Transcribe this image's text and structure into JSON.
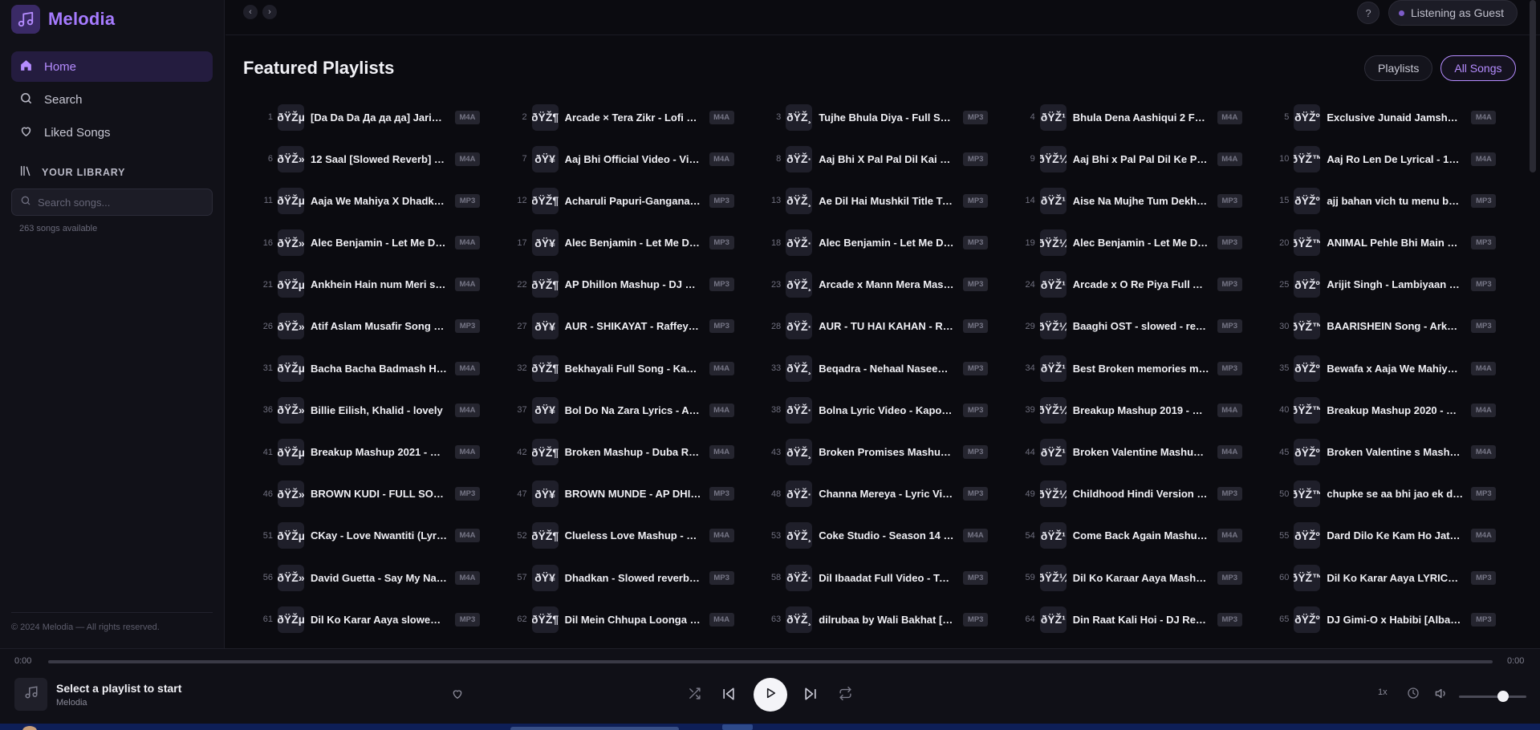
{
  "app": {
    "name": "Melodia"
  },
  "sidebar": {
    "nav": [
      {
        "label": "Home",
        "icon": "home-icon",
        "active": true
      },
      {
        "label": "Search",
        "icon": "search-icon",
        "active": false
      },
      {
        "label": "Liked Songs",
        "icon": "heart-icon",
        "active": false
      }
    ],
    "library_heading": "YOUR LIBRARY",
    "search_placeholder": "Search songs...",
    "songs_available": "263 songs available",
    "footer": "© 2024 Melodia — All rights reserved."
  },
  "topbar": {
    "back_label": "‹",
    "forward_label": "›",
    "help_label": "?",
    "guest_label": "Listening as Guest"
  },
  "main": {
    "title": "Featured Playlists",
    "toggle": [
      {
        "label": "Playlists",
        "active": false
      },
      {
        "label": "All Songs",
        "active": true
      }
    ]
  },
  "songs": [
    {
      "n": "1",
      "art": "ðŸŽµ",
      "title": "[Da Da Da Да да да] Jaric…",
      "fmt": "M4A"
    },
    {
      "n": "2",
      "art": "ðŸŽ¶",
      "title": "Arcade × Tera Zikr - Lofi …",
      "fmt": "M4A"
    },
    {
      "n": "3",
      "art": "ðŸŽ¸",
      "title": "Tujhe Bhula Diya - Full Son…",
      "fmt": "MP3"
    },
    {
      "n": "4",
      "art": "ðŸŽ¹",
      "title": "Bhula Dena Aashiqui 2 Full…",
      "fmt": "M4A"
    },
    {
      "n": "5",
      "art": "ðŸŽº",
      "title": "Exclusive Junaid Jamshed…",
      "fmt": "M4A"
    },
    {
      "n": "6",
      "art": "ðŸŽ»",
      "title": "12 Saal [Slowed Reverb] - …",
      "fmt": "M4A"
    },
    {
      "n": "7",
      "art": "ðŸ¥",
      "title": "Aaj Bhi Official Video - Vis…",
      "fmt": "M4A"
    },
    {
      "n": "8",
      "art": "ðŸŽ·",
      "title": "Aaj Bhi X Pal Pal Dil Kai Pa…",
      "fmt": "MP3"
    },
    {
      "n": "9",
      "art": "ðŸŽ¼",
      "title": "Aaj Bhi x Pal Pal Dil Ke Paa…",
      "fmt": "M4A"
    },
    {
      "n": "10",
      "art": "ðŸŽ™",
      "title": "Aaj Ro Len De Lyrical - 19…",
      "fmt": "M4A"
    },
    {
      "n": "11",
      "art": "ðŸŽµ",
      "title": "Aaja We Mahiya X Dhadka…",
      "fmt": "MP3"
    },
    {
      "n": "12",
      "art": "ðŸŽ¶",
      "title": "Acharuli Papuri-Gangana …",
      "fmt": "MP3"
    },
    {
      "n": "13",
      "art": "ðŸŽ¸",
      "title": "Ae Dil Hai Mushkil Title Tr…",
      "fmt": "MP3"
    },
    {
      "n": "14",
      "art": "ðŸŽ¹",
      "title": "Aise Na Mujhe Tum Dekho…",
      "fmt": "MP3"
    },
    {
      "n": "15",
      "art": "ðŸŽº",
      "title": "ajj bahan vich tu menu bh…",
      "fmt": "MP3"
    },
    {
      "n": "16",
      "art": "ðŸŽ»",
      "title": "Alec Benjamin - Let Me Do…",
      "fmt": "M4A"
    },
    {
      "n": "17",
      "art": "ðŸ¥",
      "title": "Alec Benjamin - Let Me Do…",
      "fmt": "MP3"
    },
    {
      "n": "18",
      "art": "ðŸŽ·",
      "title": "Alec Benjamin - Let Me Do…",
      "fmt": "MP3"
    },
    {
      "n": "19",
      "art": "ðŸŽ¼",
      "title": "Alec Benjamin - Let Me Do…",
      "fmt": "MP3"
    },
    {
      "n": "20",
      "art": "ðŸŽ™",
      "title": "ANIMAL Pehle Bhi Main Fu…",
      "fmt": "MP3"
    },
    {
      "n": "21",
      "art": "ðŸŽµ",
      "title": "Ankhein Hain num Meri sa…",
      "fmt": "M4A"
    },
    {
      "n": "22",
      "art": "ðŸŽ¶",
      "title": "AP Dhillon Mashup - DJ D…",
      "fmt": "MP3"
    },
    {
      "n": "23",
      "art": "ðŸŽ¸",
      "title": "Arcade x Mann Mera Mas…",
      "fmt": "MP3"
    },
    {
      "n": "24",
      "art": "ðŸŽ¹",
      "title": "Arcade x O Re Piya Full Au…",
      "fmt": "MP3"
    },
    {
      "n": "25",
      "art": "ðŸŽº",
      "title": "Arijit Singh - Lambiyaan Si…",
      "fmt": "MP3"
    },
    {
      "n": "26",
      "art": "ðŸŽ»",
      "title": "Atif Aslam Musafir Song - …",
      "fmt": "MP3"
    },
    {
      "n": "27",
      "art": "ðŸ¥",
      "title": "AUR - SHIKAYAT - Raffey - …",
      "fmt": "MP3"
    },
    {
      "n": "28",
      "art": "ðŸŽ·",
      "title": "AUR - TU HAI KAHAN - Ra…",
      "fmt": "MP3"
    },
    {
      "n": "29",
      "art": "ðŸŽ¼",
      "title": "Baaghi OST - slowed - rev…",
      "fmt": "MP3"
    },
    {
      "n": "30",
      "art": "ðŸŽ™",
      "title": "BAARISHEIN Song - Arko …",
      "fmt": "MP3"
    },
    {
      "n": "31",
      "art": "ðŸŽµ",
      "title": "Bacha Bacha Badmash Ho…",
      "fmt": "M4A"
    },
    {
      "n": "32",
      "art": "ðŸŽ¶",
      "title": "Bekhayali Full Song - Kabi…",
      "fmt": "M4A"
    },
    {
      "n": "33",
      "art": "ðŸŽ¸",
      "title": "Beqadra - Nehaal Naseem…",
      "fmt": "MP3"
    },
    {
      "n": "34",
      "art": "ðŸŽ¹",
      "title": "Best Broken memories ma…",
      "fmt": "MP3"
    },
    {
      "n": "35",
      "art": "ðŸŽº",
      "title": "Bewafa x Aaja We Mahiya …",
      "fmt": "M4A"
    },
    {
      "n": "36",
      "art": "ðŸŽ»",
      "title": "Billie Eilish, Khalid - lovely",
      "fmt": "M4A"
    },
    {
      "n": "37",
      "art": "ðŸ¥",
      "title": "Bol Do Na Zara Lyrics - Ar…",
      "fmt": "M4A"
    },
    {
      "n": "38",
      "art": "ðŸŽ·",
      "title": "Bolna Lyric Video - Kapoo…",
      "fmt": "MP3"
    },
    {
      "n": "39",
      "art": "ðŸŽ¼",
      "title": "Breakup Mashup 2019 - D…",
      "fmt": "M4A"
    },
    {
      "n": "40",
      "art": "ðŸŽ™",
      "title": "Breakup Mashup 2020 - Y…",
      "fmt": "M4A"
    },
    {
      "n": "41",
      "art": "ðŸŽµ",
      "title": "Breakup Mashup 2021 - Dj…",
      "fmt": "M4A"
    },
    {
      "n": "42",
      "art": "ðŸŽ¶",
      "title": "Broken Mashup - Duba Ra…",
      "fmt": "M4A"
    },
    {
      "n": "43",
      "art": "ðŸŽ¸",
      "title": "Broken Promises Mashup …",
      "fmt": "MP3"
    },
    {
      "n": "44",
      "art": "ðŸŽ¹",
      "title": "Broken Valentine Mashup …",
      "fmt": "M4A"
    },
    {
      "n": "45",
      "art": "ðŸŽº",
      "title": "Broken Valentine s Mashu…",
      "fmt": "M4A"
    },
    {
      "n": "46",
      "art": "ðŸŽ»",
      "title": "BROWN KUDI - FULL SON…",
      "fmt": "MP3"
    },
    {
      "n": "47",
      "art": "ðŸ¥",
      "title": "BROWN MUNDE - AP DHIL…",
      "fmt": "MP3"
    },
    {
      "n": "48",
      "art": "ðŸŽ·",
      "title": "Channa Mereya - Lyric Vid…",
      "fmt": "MP3"
    },
    {
      "n": "49",
      "art": "ðŸŽ¼",
      "title": "Childhood Hindi Version - …",
      "fmt": "MP3"
    },
    {
      "n": "50",
      "art": "ðŸŽ™",
      "title": "chupke se aa bhi jao ek di…",
      "fmt": "MP3"
    },
    {
      "n": "51",
      "art": "ðŸŽµ",
      "title": "CKay - Love Nwantiti (Lyri…",
      "fmt": "M4A"
    },
    {
      "n": "52",
      "art": "ðŸŽ¶",
      "title": "Clueless Love Mashup - J…",
      "fmt": "M4A"
    },
    {
      "n": "53",
      "art": "ðŸŽ¸",
      "title": "Coke Studio - Season 14 -…",
      "fmt": "M4A"
    },
    {
      "n": "54",
      "art": "ðŸŽ¹",
      "title": "Come Back Again Mashup…",
      "fmt": "M4A"
    },
    {
      "n": "55",
      "art": "ðŸŽº",
      "title": "Dard Dilo Ke Kam Ho Jate…",
      "fmt": "M4A"
    },
    {
      "n": "56",
      "art": "ðŸŽ»",
      "title": "David Guetta - Say My Na…",
      "fmt": "M4A"
    },
    {
      "n": "57",
      "art": "ðŸ¥",
      "title": "Dhadkan - Slowed reverb …",
      "fmt": "MP3"
    },
    {
      "n": "58",
      "art": "ðŸŽ·",
      "title": "Dil Ibaadat Full Video - Tu…",
      "fmt": "MP3"
    },
    {
      "n": "59",
      "art": "ðŸŽ¼",
      "title": "Dil Ko Karaar Aaya Mashu…",
      "fmt": "MP3"
    },
    {
      "n": "60",
      "art": "ðŸŽ™",
      "title": "Dil Ko Karar Aaya LYRICS …",
      "fmt": "MP3"
    },
    {
      "n": "61",
      "art": "ðŸŽµ",
      "title": "Dil Ko Karar Aaya slowed -…",
      "fmt": "MP3"
    },
    {
      "n": "62",
      "art": "ðŸŽ¶",
      "title": "Dil Mein Chhupa Loonga -…",
      "fmt": "M4A"
    },
    {
      "n": "63",
      "art": "ðŸŽ¸",
      "title": "dilrubaa by Wali Bakhat [ly…",
      "fmt": "MP3"
    },
    {
      "n": "64",
      "art": "ðŸŽ¹",
      "title": "Din Raat Kali Hoi - DJ Rem…",
      "fmt": "MP3"
    },
    {
      "n": "65",
      "art": "ðŸŽº",
      "title": "DJ Gimi-O x Habibi [Albani…",
      "fmt": "MP3"
    }
  ],
  "player": {
    "time_current": "0:00",
    "time_total": "0:00",
    "progress": 0,
    "now_title": "Select a playlist to start",
    "now_sub": "Melodia",
    "speed": "1x",
    "volume": 0.65
  },
  "colors": {
    "accent": "#a67bff",
    "background": "#0b0b10",
    "sidebar": "#111118"
  }
}
